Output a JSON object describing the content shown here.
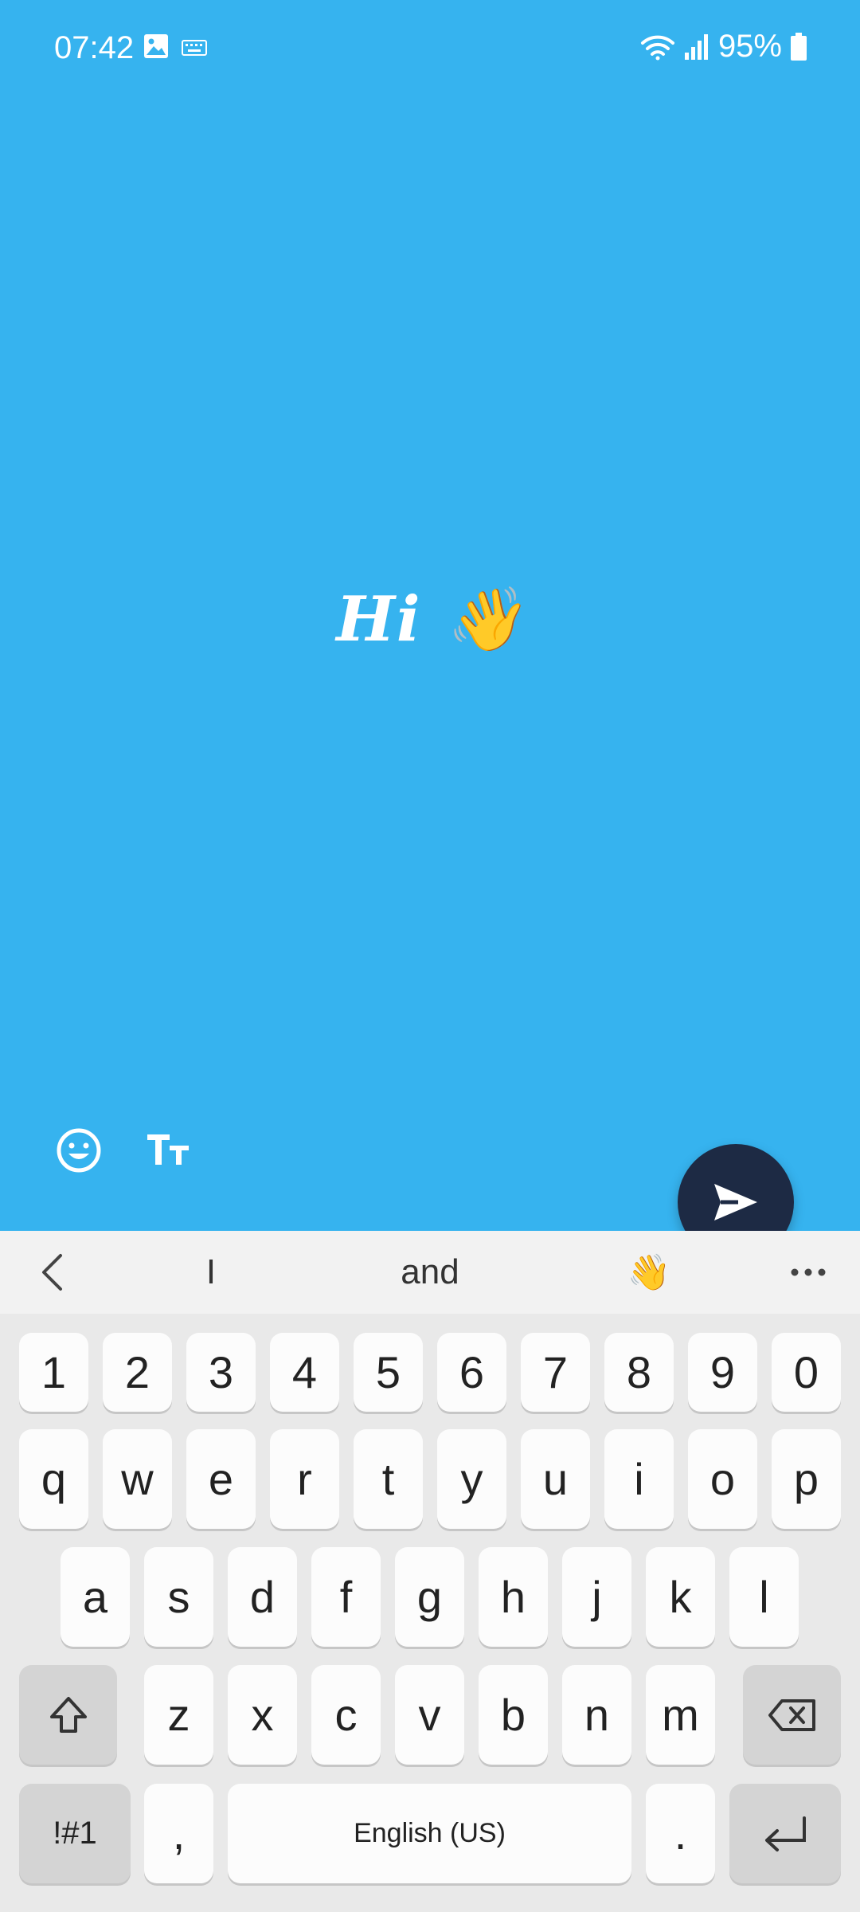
{
  "status_bar": {
    "time": "07:42",
    "battery": "95%"
  },
  "story": {
    "text": "Hi 👋"
  },
  "suggestions": {
    "items": [
      "I",
      "and",
      "👋"
    ]
  },
  "keyboard": {
    "numbers": [
      "1",
      "2",
      "3",
      "4",
      "5",
      "6",
      "7",
      "8",
      "9",
      "0"
    ],
    "row1": [
      "q",
      "w",
      "e",
      "r",
      "t",
      "y",
      "u",
      "i",
      "o",
      "p"
    ],
    "row2": [
      "a",
      "s",
      "d",
      "f",
      "g",
      "h",
      "j",
      "k",
      "l"
    ],
    "row3": [
      "z",
      "x",
      "c",
      "v",
      "b",
      "n",
      "m"
    ],
    "symbols_label": "!#1",
    "comma": ",",
    "space_label": "English (US)",
    "period": "."
  },
  "colors": {
    "background": "#36b3ef",
    "send_button": "#1d2a44"
  }
}
